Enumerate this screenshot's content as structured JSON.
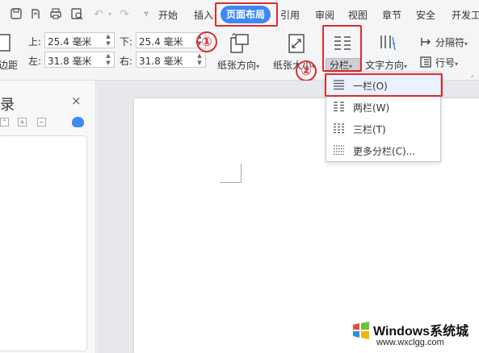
{
  "menubar": {
    "items": [
      "开始",
      "插入",
      "页面布局",
      "引用",
      "审阅",
      "视图",
      "章节",
      "安全",
      "开发工"
    ],
    "active_index": 2
  },
  "margins": {
    "top_label": "上:",
    "top_value": "25.4 毫米",
    "bottom_label": "下:",
    "bottom_value": "25.4 毫米",
    "left_label": "左:",
    "left_value": "31.8 毫米",
    "right_label": "右:",
    "right_value": "31.8 毫米",
    "margin_btn_label": "边距"
  },
  "ribbon": {
    "orientation_label": "纸张方向",
    "size_label": "纸张大小",
    "columns_label": "分栏",
    "text_direction_label": "文字方向",
    "separator_label": "分隔符",
    "line_number_label": "行号"
  },
  "annotations": {
    "step1": "①",
    "step2": "②",
    "color": "#e02a2a"
  },
  "navpane": {
    "title": "录",
    "close": "×"
  },
  "columns_menu": {
    "items": [
      {
        "label": "一栏(O)",
        "icon": "one-column-icon"
      },
      {
        "label": "两栏(W)",
        "icon": "two-column-icon"
      },
      {
        "label": "三栏(T)",
        "icon": "three-column-icon"
      },
      {
        "label": "更多分栏(C)...",
        "icon": "more-columns-icon"
      }
    ]
  },
  "watermark": {
    "title": "Windows系统城",
    "url": "www.wxclgg.com"
  },
  "colors": {
    "accent": "#3f88f4",
    "annotation": "#e02a2a"
  }
}
